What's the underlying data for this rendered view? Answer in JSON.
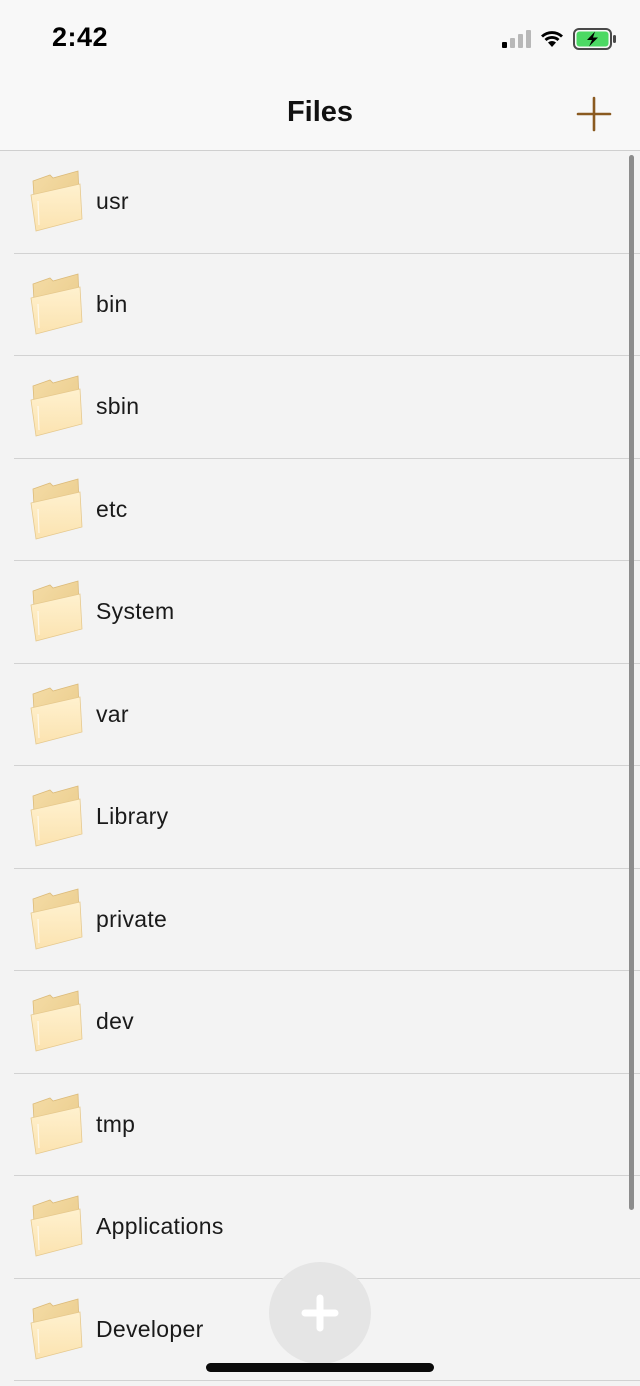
{
  "status_bar": {
    "time": "2:42",
    "icons": [
      "cellular-signal-icon",
      "wifi-icon",
      "battery-charging-icon"
    ],
    "battery_color": "#4cd964"
  },
  "nav": {
    "title": "Files",
    "add_icon": "plus-icon",
    "accent_color": "#8a5a20"
  },
  "files": {
    "folder_icon": "folder-icon",
    "items": [
      {
        "label": "usr"
      },
      {
        "label": "bin"
      },
      {
        "label": "sbin"
      },
      {
        "label": "etc"
      },
      {
        "label": "System"
      },
      {
        "label": "var"
      },
      {
        "label": "Library"
      },
      {
        "label": "private"
      },
      {
        "label": "dev"
      },
      {
        "label": "tmp"
      },
      {
        "label": "Applications"
      },
      {
        "label": "Developer"
      }
    ]
  },
  "fab": {
    "icon": "plus-icon"
  }
}
